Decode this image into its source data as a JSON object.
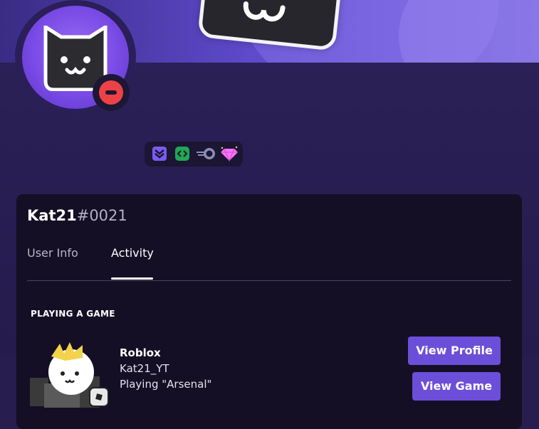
{
  "profile": {
    "username": "Kat21",
    "discriminator": "#0021",
    "status": "do-not-disturb"
  },
  "badges": [
    {
      "icon": "hypesquad-badge-icon",
      "color": "#7b5cf0"
    },
    {
      "icon": "active-developer-badge-icon",
      "color": "#23a55a"
    },
    {
      "icon": "nitro-badge-icon",
      "color": "#8a8fb5"
    },
    {
      "icon": "server-boost-gem-icon",
      "color": "#ff73fa"
    }
  ],
  "tabs": [
    {
      "label": "User Info",
      "active": false
    },
    {
      "label": "Activity",
      "active": true
    }
  ],
  "activity": {
    "section_title": "PLAYING A GAME",
    "game_name": "Roblox",
    "detail": "Kat21_YT",
    "state": "Playing \"Arsenal\"",
    "buttons": {
      "view_profile": "View Profile",
      "view_game": "View Game"
    }
  },
  "colors": {
    "accent": "#6c4fd9",
    "dnd": "#ed4245",
    "banner": "#5d49c9"
  }
}
